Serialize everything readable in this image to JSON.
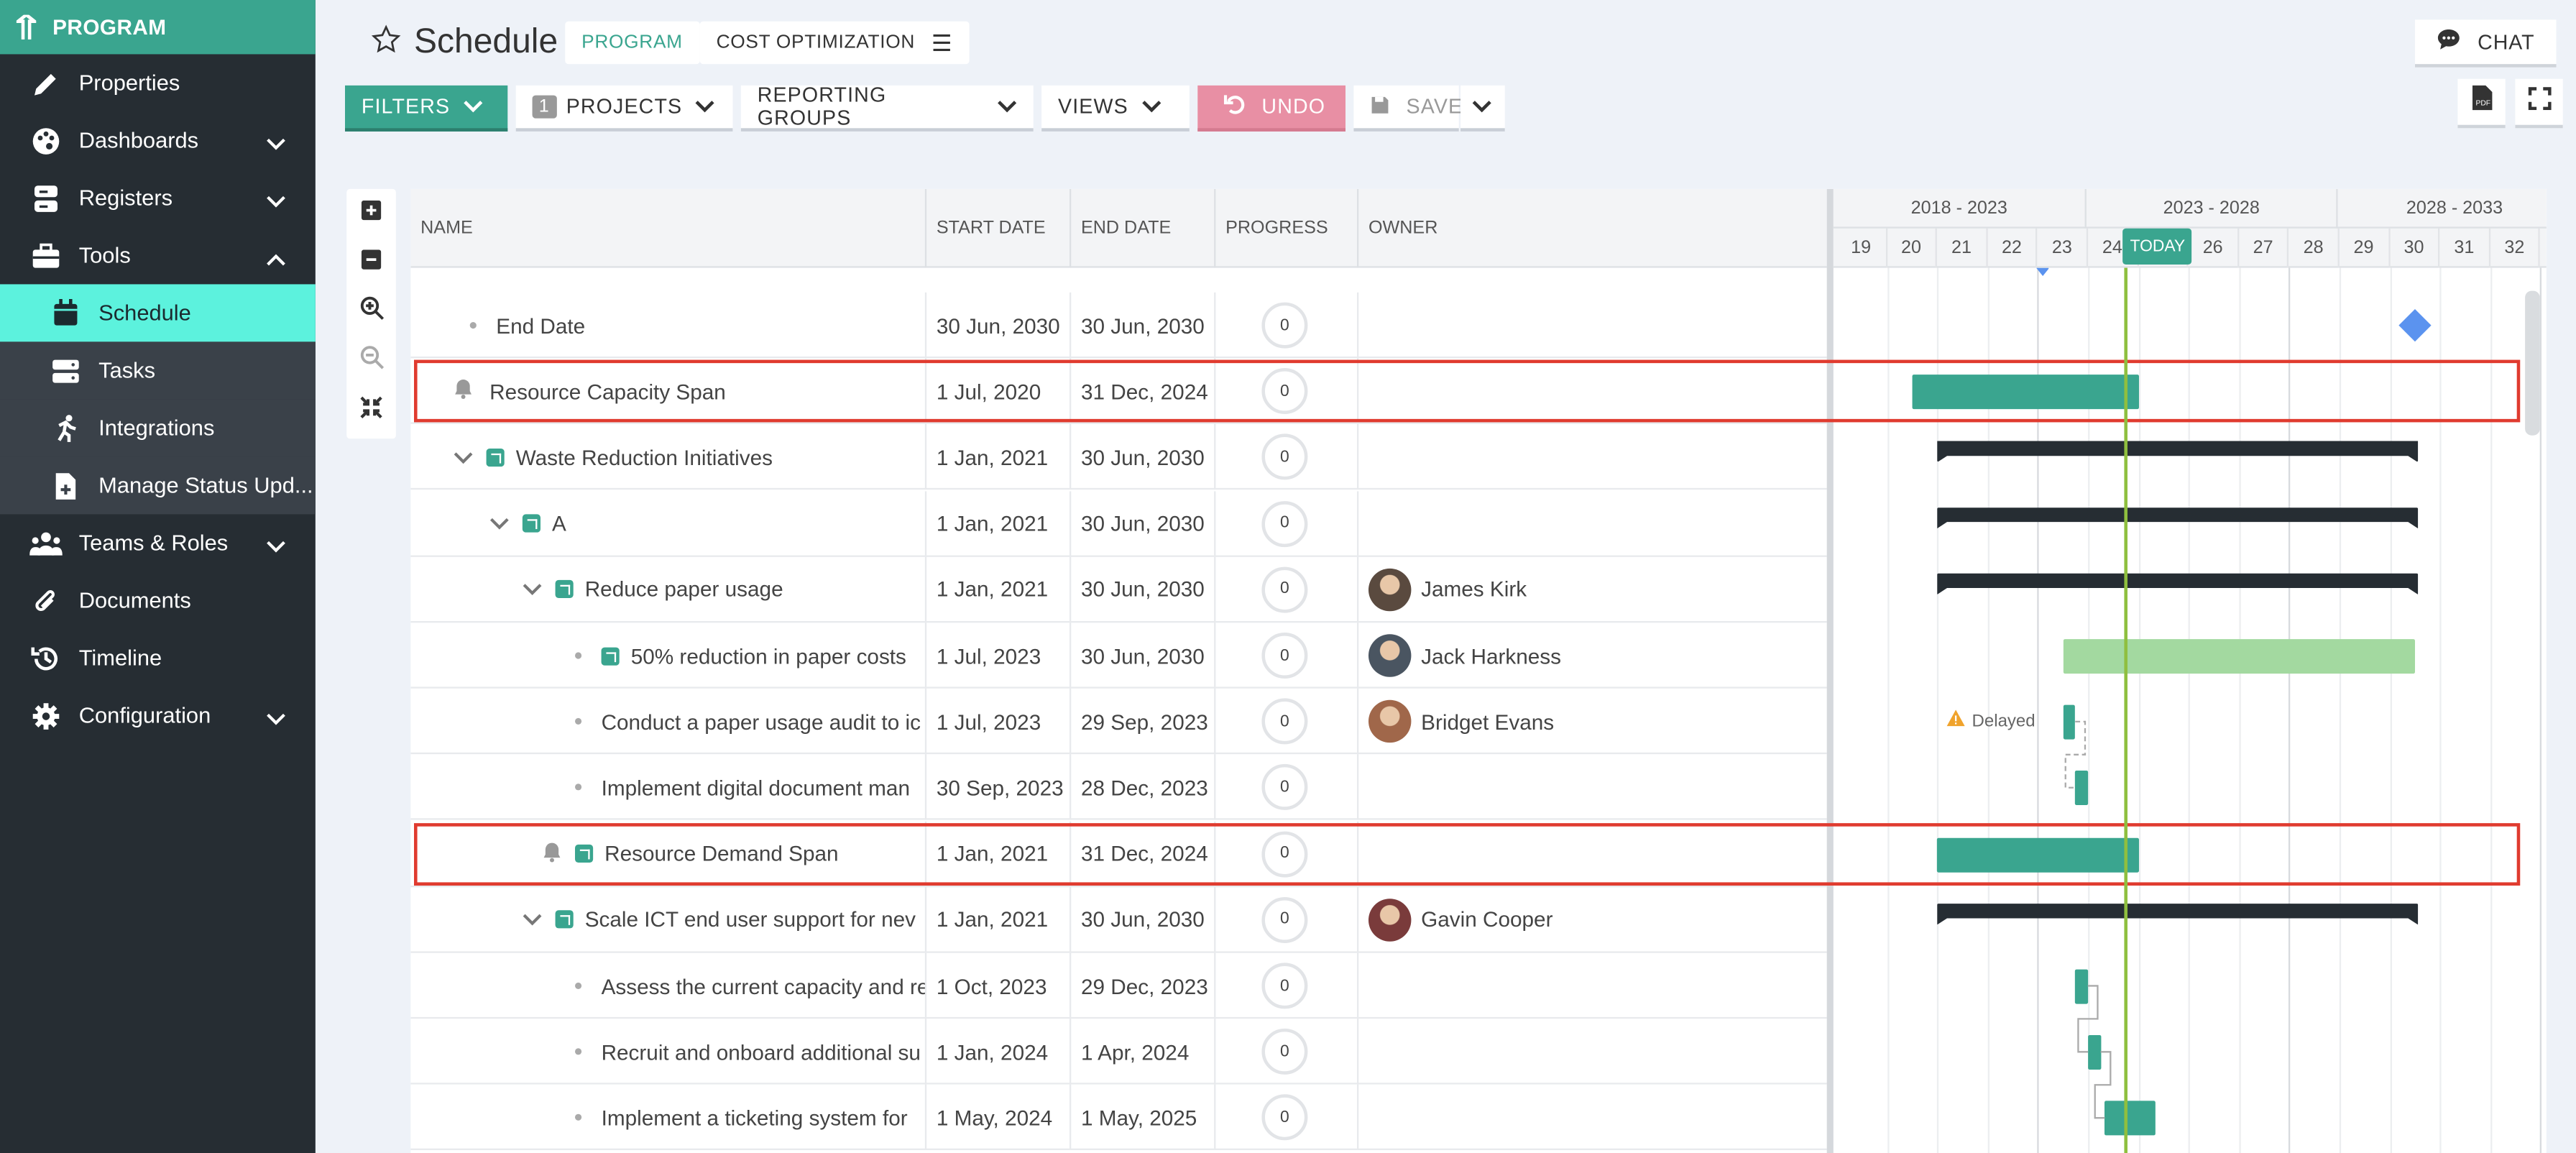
{
  "brand": {
    "label": "PROGRAM"
  },
  "nav": [
    {
      "label": "Properties",
      "icon": "pencil-icon"
    },
    {
      "label": "Dashboards",
      "icon": "palette-icon",
      "expand": "down"
    },
    {
      "label": "Registers",
      "icon": "database-icon",
      "expand": "down"
    },
    {
      "label": "Tools",
      "icon": "toolbox-icon",
      "expand": "up"
    }
  ],
  "subnav": [
    {
      "label": "Schedule",
      "icon": "calendar-icon",
      "active": true
    },
    {
      "label": "Tasks",
      "icon": "list-icon"
    },
    {
      "label": "Integrations",
      "icon": "running-person-icon"
    },
    {
      "label": "Manage Status Upd...",
      "icon": "document-plus-icon"
    }
  ],
  "nav2": [
    {
      "label": "Teams & Roles",
      "icon": "people-icon",
      "expand": "down"
    },
    {
      "label": "Documents",
      "icon": "paperclip-icon"
    },
    {
      "label": "Timeline",
      "icon": "history-icon"
    },
    {
      "label": "Configuration",
      "icon": "gear-icon",
      "expand": "down"
    }
  ],
  "header": {
    "title": "Schedule",
    "tag_program": "PROGRAM",
    "tag_project": "COST OPTIMIZATION",
    "chat": "CHAT"
  },
  "toolbar": {
    "filters": "FILTERS",
    "projects_count": "1",
    "projects": "PROJECTS",
    "reporting": "REPORTING GROUPS",
    "views": "VIEWS",
    "undo": "UNDO",
    "save": "SAVE"
  },
  "columns": {
    "name": "NAME",
    "start": "START DATE",
    "end": "END DATE",
    "progress": "PROGRESS",
    "owner": "OWNER"
  },
  "eras": [
    "2018 - 2023",
    "2023 - 2028",
    "2028 - 2033"
  ],
  "years": [
    "19",
    "20",
    "21",
    "22",
    "23",
    "24",
    "25",
    "26",
    "27",
    "28",
    "29",
    "30",
    "31",
    "32"
  ],
  "today_label": "TODAY",
  "delayed_label": "Delayed",
  "rows": [
    {
      "name": "End Date",
      "start": "30 Jun, 2030",
      "end": "30 Jun, 2030",
      "progress": "0",
      "owner": "",
      "indent": 1,
      "kind": "dot"
    },
    {
      "name": "Resource Capacity Span",
      "start": "1 Jul, 2020",
      "end": "31 Dec, 2024",
      "progress": "0",
      "owner": "",
      "indent": 1,
      "kind": "bell",
      "highlight": true
    },
    {
      "name": "Waste Reduction Initiatives",
      "start": "1 Jan, 2021",
      "end": "30 Jun, 2030",
      "progress": "0",
      "owner": "",
      "indent": 1,
      "kind": "group"
    },
    {
      "name": "A",
      "start": "1 Jan, 2021",
      "end": "30 Jun, 2030",
      "progress": "0",
      "owner": "",
      "indent": 2,
      "kind": "group"
    },
    {
      "name": "Reduce paper usage",
      "start": "1 Jan, 2021",
      "end": "30 Jun, 2030",
      "progress": "0",
      "owner": "James Kirk",
      "indent": 3,
      "kind": "group"
    },
    {
      "name": "50% reduction in paper costs",
      "start": "1 Jul, 2023",
      "end": "30 Jun, 2030",
      "progress": "0",
      "owner": "Jack Harkness",
      "indent": 4,
      "kind": "dotsq"
    },
    {
      "name": "Conduct a paper usage audit to ic",
      "start": "1 Jul, 2023",
      "end": "29 Sep, 2023",
      "progress": "0",
      "owner": "Bridget Evans",
      "indent": 4,
      "kind": "dot"
    },
    {
      "name": "Implement digital document man",
      "start": "30 Sep, 2023",
      "end": "28 Dec, 2023",
      "progress": "0",
      "owner": "",
      "indent": 4,
      "kind": "dot"
    },
    {
      "name": "Resource Demand Span",
      "start": "1 Jan, 2021",
      "end": "31 Dec, 2024",
      "progress": "0",
      "owner": "",
      "indent": 4,
      "kind": "bellsq",
      "highlight": true
    },
    {
      "name": "Scale ICT end user support for nev",
      "start": "1 Jan, 2021",
      "end": "30 Jun, 2030",
      "progress": "0",
      "owner": "Gavin Cooper",
      "indent": 3,
      "kind": "group"
    },
    {
      "name": "Assess the current capacity and re",
      "start": "1 Oct, 2023",
      "end": "29 Dec, 2023",
      "progress": "0",
      "owner": "",
      "indent": 4,
      "kind": "dot"
    },
    {
      "name": "Recruit and onboard additional su",
      "start": "1 Jan, 2024",
      "end": "1 Apr, 2024",
      "progress": "0",
      "owner": "",
      "indent": 4,
      "kind": "dot"
    },
    {
      "name": "Implement a ticketing system for",
      "start": "1 May, 2024",
      "end": "1 May, 2025",
      "progress": "0",
      "owner": "",
      "indent": 4,
      "kind": "dot"
    }
  ],
  "colors": {
    "teal": "#3aa58f",
    "dark": "#262d33",
    "light_green": "#a3d9a0",
    "highlight": "#e03b2f",
    "milestone": "#5b93ef"
  }
}
